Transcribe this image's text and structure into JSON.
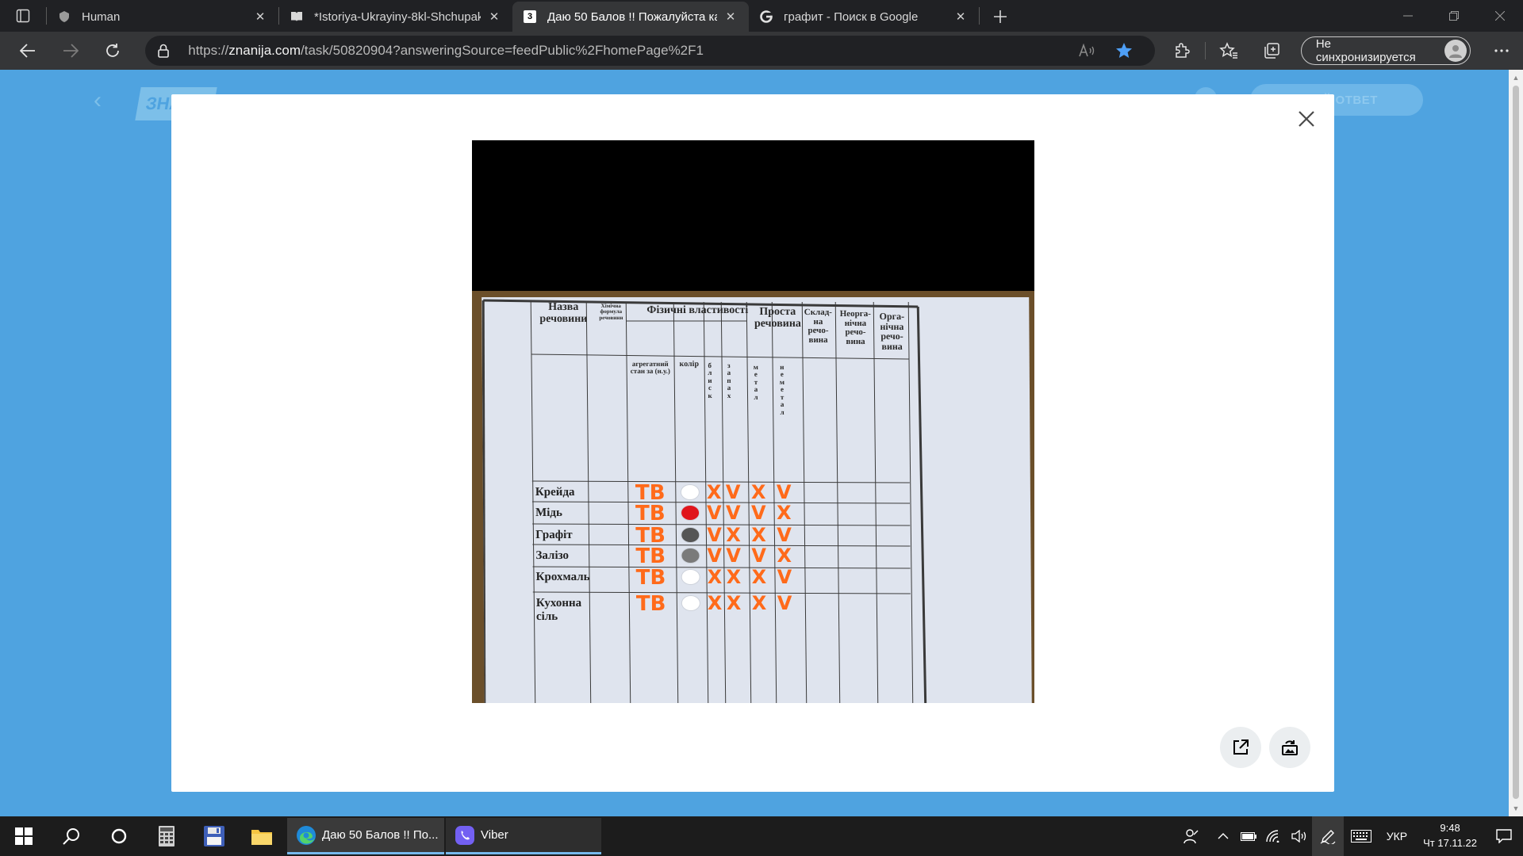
{
  "browser": {
    "tabs": [
      {
        "title": "Human",
        "icon": "shield-icon"
      },
      {
        "title": "*Istoriya-Ukrayiny-8kl-Shchupak",
        "icon": "book-icon"
      },
      {
        "title": "Даю 50 Балов !! Пожалуйста ка",
        "icon": "znanija-icon",
        "active": true,
        "favicon_text": "3"
      },
      {
        "title": "графит - Поиск в Google",
        "icon": "google-icon"
      }
    ],
    "url_prefix": "https://",
    "url_host": "znanija.com",
    "url_path": "/task/50820904?answeringSource=feedPublic%2FhomePage%2F1",
    "profile_label": "Не синхронизируется",
    "accent": "#4fa3e0"
  },
  "page": {
    "background_logo": "ЗНАНИЯ",
    "background_cta": "СВОЙ ОТВЕТ"
  },
  "worksheet": {
    "headers": {
      "name": "Назва речовини",
      "formula": "Хімічна формула речовини",
      "physical": "Фізичні властивості",
      "simple": "Проста речовина",
      "complex": "Склад-на речо-вина",
      "inorganic": "Неорга-нічна речо-вина",
      "organic": "Орга-нічна речо-вина",
      "state": "агрегатний стан за (н.у.)",
      "color": "колір",
      "luster": "б л и с к",
      "smell": "з а п а х",
      "metal": "м е т а л",
      "nonmetal": "н е м е т а л"
    },
    "rows": [
      {
        "name": "Крейда",
        "state": "ТВ",
        "color": "#ffffff",
        "luster": "X",
        "smell": "V",
        "metal": "X",
        "nonmetal": "V"
      },
      {
        "name": "Мідь",
        "state": "ТВ",
        "color": "#e0141c",
        "luster": "V",
        "smell": "V",
        "metal": "V",
        "nonmetal": "X"
      },
      {
        "name": "Графіт",
        "state": "ТВ",
        "color": "#555555",
        "luster": "V",
        "smell": "X",
        "metal": "X",
        "nonmetal": "V"
      },
      {
        "name": "Залізо",
        "state": "ТВ",
        "color": "#7a7a7a",
        "luster": "V",
        "smell": "V",
        "metal": "V",
        "nonmetal": "X"
      },
      {
        "name": "Крохмаль",
        "state": "ТВ",
        "color": "#ffffff",
        "luster": "X",
        "smell": "X",
        "metal": "X",
        "nonmetal": "V"
      },
      {
        "name": "Кухонна сіль",
        "state": "ТВ",
        "color": "#ffffff",
        "luster": "X",
        "smell": "X",
        "metal": "X",
        "nonmetal": "V"
      }
    ],
    "mark_color": "#ff6a1a"
  },
  "taskbar": {
    "apps": [
      {
        "label": "Даю 50 Балов !! По...",
        "icon": "edge-icon"
      },
      {
        "label": "Viber",
        "icon": "viber-icon"
      }
    ],
    "language": "УКР",
    "time": "9:48",
    "date": "Чт 17.11.22"
  }
}
